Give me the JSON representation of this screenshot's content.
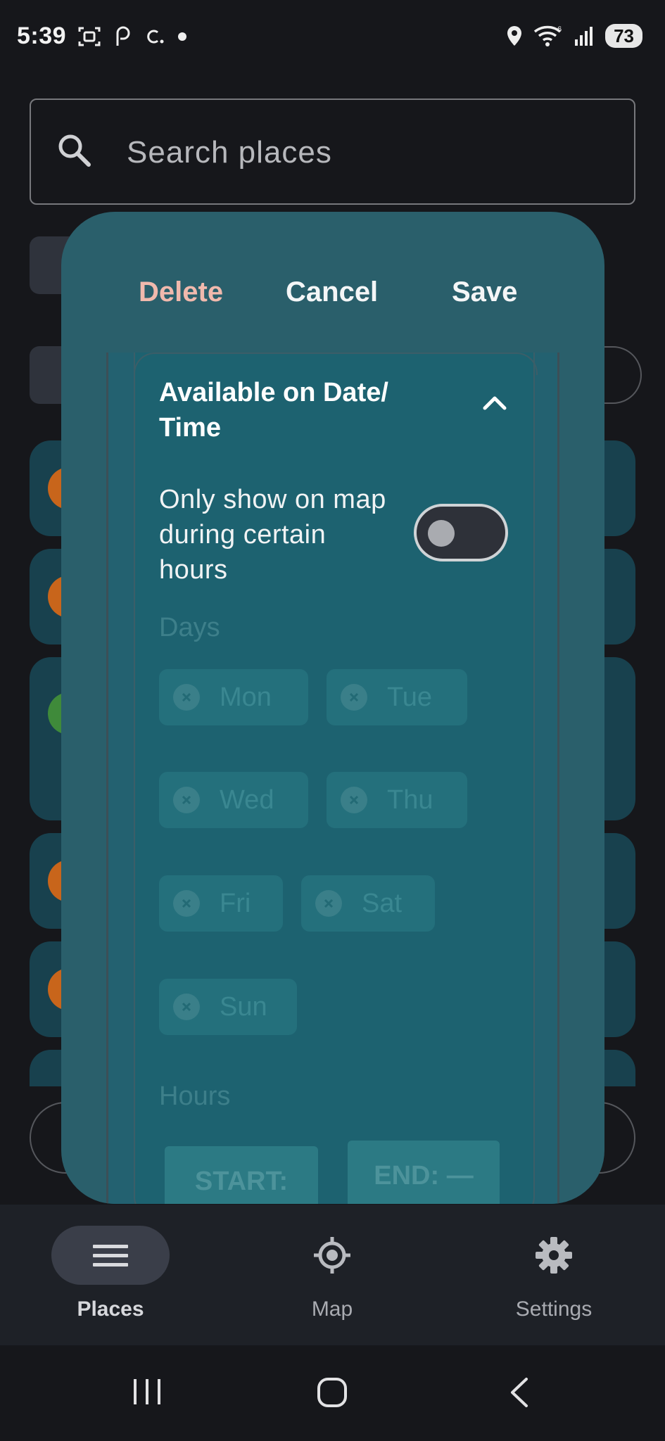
{
  "status_bar": {
    "time": "5:39",
    "battery": "73",
    "left_icons": [
      "screenshot-icon",
      "podcast-icon",
      "c-icon",
      "dot-icon"
    ],
    "right_icons": [
      "location-icon",
      "wifi-icon",
      "signal-icon"
    ]
  },
  "search": {
    "placeholder": "Search places"
  },
  "dialog": {
    "actions": {
      "delete": "Delete",
      "cancel": "Cancel",
      "save": "Save"
    },
    "section": {
      "title": "Available on Date/ Time",
      "toggle_label": "Only show on map during certain hours",
      "toggle_on": false,
      "days_label": "Days",
      "days": [
        "Mon",
        "Tue",
        "Wed",
        "Thu",
        "Fri",
        "Sat",
        "Sun"
      ],
      "hours_label": "Hours",
      "start_label": "START:",
      "end_label": "END: —"
    }
  },
  "bottom_nav": {
    "items": [
      {
        "label": "Places",
        "icon": "menu-icon",
        "active": true
      },
      {
        "label": "Map",
        "icon": "crosshair-icon",
        "active": false
      },
      {
        "label": "Settings",
        "icon": "gear-icon",
        "active": false
      }
    ]
  },
  "colors": {
    "dialog_bg": "#2a5f6b",
    "delete_accent": "#f0b9ad",
    "bg": "#16171b"
  }
}
